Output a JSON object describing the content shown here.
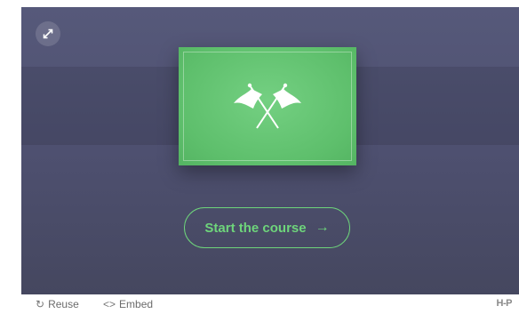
{
  "stage": {
    "start_button_label": "Start the course",
    "start_button_arrow": "→",
    "fullscreen_icon": "expand-icon",
    "card_icon": "crossed-flags-icon",
    "accent_color": "#6ed57b",
    "card_color": "#5ebf6c",
    "background_color": "#4e5070"
  },
  "footer": {
    "reuse_label": "Reuse",
    "reuse_icon": "↻",
    "embed_label": "Embed",
    "embed_icon": "<>",
    "brand": "H-P"
  }
}
